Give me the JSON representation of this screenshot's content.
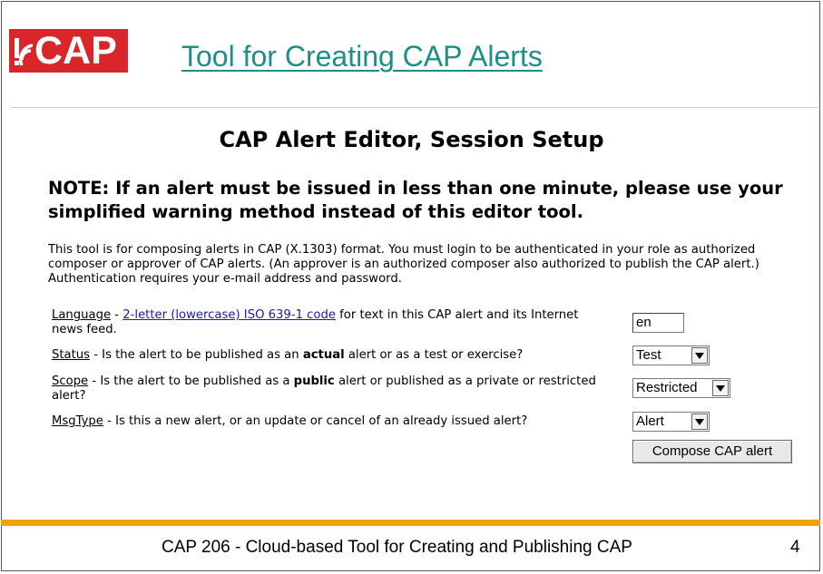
{
  "logo": {
    "text": "CAP"
  },
  "slide_title": "Tool for Creating CAP Alerts",
  "editor_title": "CAP Alert Editor, Session Setup",
  "note": "NOTE: If an alert must be issued in less than one minute, please use your simplified warning method instead of this editor tool.",
  "intro": "This tool is for composing alerts in CAP (X.1303) format. You must login to be authenticated in your role as authorized composer or approver of CAP alerts. (An approver is an authorized composer also authorized to publish the CAP alert.) Authentication requires your e-mail address and password.",
  "language": {
    "term": "Language",
    "sep": " - ",
    "link": "2-letter (lowercase) ISO 639-1 code",
    "rest": " for text in this CAP alert and its Internet news feed.",
    "value": "en"
  },
  "status": {
    "term": "Status",
    "pre": " - Is the alert to be published as an ",
    "bold": "actual",
    "post": " alert or as a test or exercise?",
    "selected": "Test"
  },
  "scope": {
    "term": "Scope",
    "pre": " - Is the alert to be published as a ",
    "bold": "public",
    "post": " alert or published as a private or restricted alert?",
    "selected": "Restricted"
  },
  "msgtype": {
    "term": "MsgType",
    "text": " - Is this a new alert, or an update or cancel of an already issued alert?",
    "selected": "Alert"
  },
  "compose_button": "Compose CAP alert",
  "footer": {
    "text": "CAP 206 - Cloud-based Tool for Creating and Publishing CAP",
    "page_number": "4"
  },
  "colors": {
    "logo_red": "#d8262b",
    "title_teal": "#1c8f86",
    "accent_bar": "#f2a10b",
    "link_blue": "#1a1aa6"
  }
}
